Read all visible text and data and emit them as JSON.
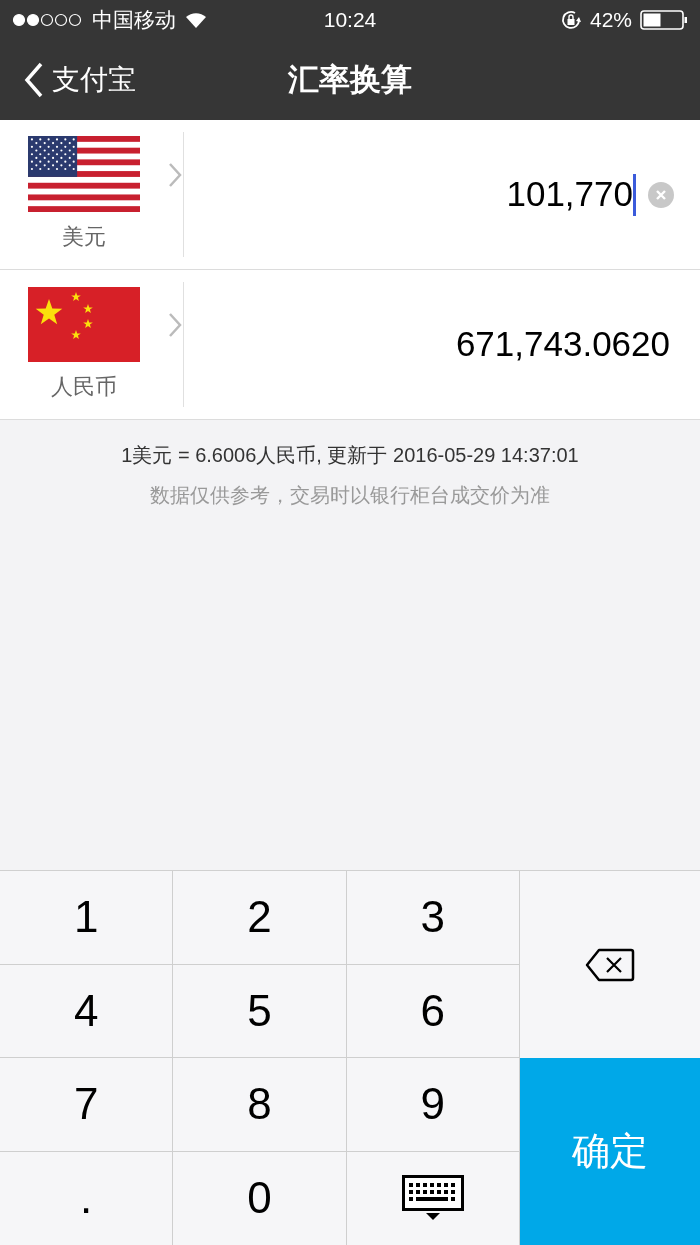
{
  "status_bar": {
    "carrier": "中国移动",
    "time": "10:24",
    "battery": "42%"
  },
  "nav": {
    "back": "支付宝",
    "title": "汇率换算"
  },
  "currencies": [
    {
      "kind": "usd",
      "name": "美元",
      "amount": "101,770",
      "active": true
    },
    {
      "kind": "cny",
      "name": "人民币",
      "amount": "671,743.0620",
      "active": false
    }
  ],
  "rate_line": "1美元 = 6.6006人民币, 更新于 2016-05-29 14:37:01",
  "disclaimer": "数据仅供参考，交易时以银行柜台成交价为准",
  "keys": [
    {
      "kind": "digit",
      "label": "1"
    },
    {
      "kind": "digit",
      "label": "2"
    },
    {
      "kind": "digit",
      "label": "3"
    },
    {
      "kind": "digit",
      "label": "4"
    },
    {
      "kind": "digit",
      "label": "5"
    },
    {
      "kind": "digit",
      "label": "6"
    },
    {
      "kind": "digit",
      "label": "7"
    },
    {
      "kind": "digit",
      "label": "8"
    },
    {
      "kind": "digit",
      "label": "9"
    },
    {
      "kind": "digit",
      "label": "."
    },
    {
      "kind": "digit",
      "label": "0"
    },
    {
      "kind": "hide"
    }
  ],
  "confirm": "确定"
}
